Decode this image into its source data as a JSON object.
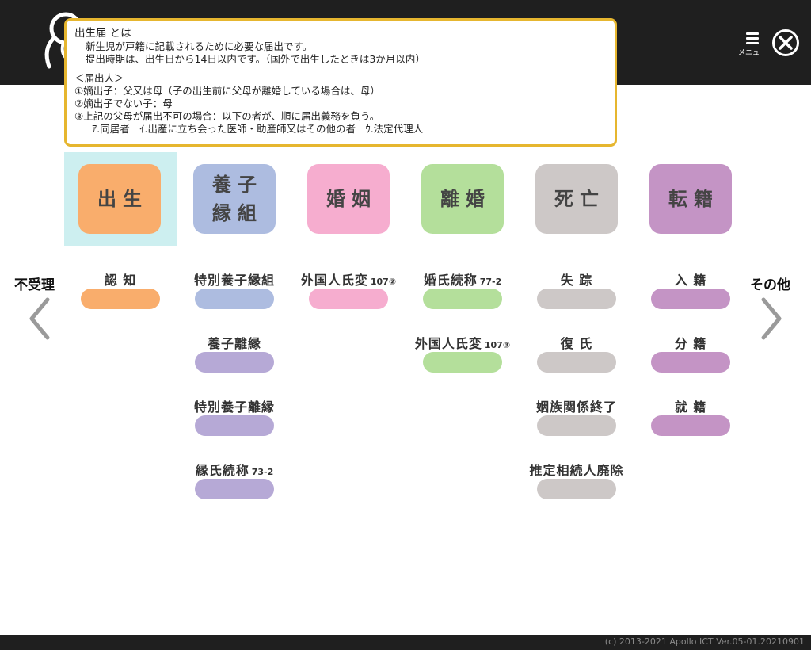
{
  "header": {
    "logo_icon": "mascot-logo-icon",
    "menu_label": "メニュー",
    "close_icon": "close-circle-icon"
  },
  "info": {
    "title": "出生届 とは",
    "line1": "新生児が戸籍に記載されるために必要な届出です。",
    "line2": "提出時期は、出生日から14日以内です。（国外で出生したときは3か月以内）",
    "notifier_heading": "＜届出人＞",
    "rule1": "①嫡出子：父又は母（子の出生前に父母が離婚している場合は、母）",
    "rule2": "②嫡出子でない子：母",
    "rule3": "③上記の父母が届出不可の場合：以下の者が、順に届出義務を負う。",
    "rule4": "ｱ.同居者　ｲ.出産に立ち会った医師・助産師又はその他の者　ｳ.法定代理人",
    "border_color": "#e6b62f"
  },
  "categories": [
    {
      "label": "出生",
      "color": "#f9ad6c",
      "selected": true
    },
    {
      "label": "養子\n縁組",
      "color": "#adbce0"
    },
    {
      "label": "婚姻",
      "color": "#f6adcf"
    },
    {
      "label": "離婚",
      "color": "#b4df9b"
    },
    {
      "label": "死亡",
      "color": "#cdc8c7"
    },
    {
      "label": "転籍",
      "color": "#c494c5"
    }
  ],
  "subs": [
    {
      "label": "認 知",
      "num": "",
      "color": "#f9ad6c"
    },
    {
      "label": "特別養子縁組",
      "num": "",
      "color": "#adbce0"
    },
    {
      "label": "養子離縁",
      "num": "",
      "color": "#b6a9d6"
    },
    {
      "label": "特別養子離縁",
      "num": "",
      "color": "#b6a9d6"
    },
    {
      "label": "縁氏続称",
      "num": "73-2",
      "color": "#b6a9d6"
    },
    {
      "label": "外国人氏変",
      "num": "107②",
      "color": "#f6adcf"
    },
    {
      "label": "婚氏続称",
      "num": "77-2",
      "color": "#b4df9b"
    },
    {
      "label": "外国人氏変",
      "num": "107③",
      "color": "#b4df9b"
    },
    {
      "label": "失 踪",
      "num": "",
      "color": "#cdc8c7"
    },
    {
      "label": "復 氏",
      "num": "",
      "color": "#cdc8c7"
    },
    {
      "label": "姻族関係終了",
      "num": "",
      "color": "#cdc8c7"
    },
    {
      "label": "推定相続人廃除",
      "num": "",
      "color": "#cdc8c7"
    },
    {
      "label": "入 籍",
      "num": "",
      "color": "#c494c5"
    },
    {
      "label": "分 籍",
      "num": "",
      "color": "#c494c5"
    },
    {
      "label": "就 籍",
      "num": "",
      "color": "#c494c5"
    }
  ],
  "nav": {
    "left_label": "不受理",
    "right_label": "その他",
    "left_icon": "chevron-left-icon",
    "right_icon": "chevron-right-icon"
  },
  "footer": {
    "copyright": "(c) 2013-2021 Apollo ICT  Ver.05-01.20210901"
  }
}
